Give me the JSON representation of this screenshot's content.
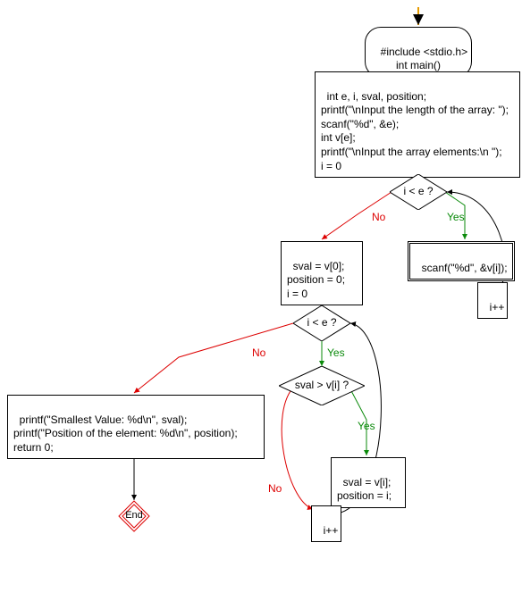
{
  "chart_data": {
    "type": "flowchart",
    "nodes": [
      {
        "id": "start",
        "kind": "start",
        "label": ""
      },
      {
        "id": "header",
        "kind": "rounded",
        "label": "#include <stdio.h>\nint main()"
      },
      {
        "id": "decl",
        "kind": "process",
        "label": "int e, i, sval, position;\nprintf(\"\\nInput the length of the array: \");\nscanf(\"%d\", &e);\nint v[e];\nprintf(\"\\nInput the array elements:\\n \");\ni = 0"
      },
      {
        "id": "cond1",
        "kind": "decision",
        "label": "i < e ?"
      },
      {
        "id": "scan",
        "kind": "process",
        "label": "scanf(\"%d\", &v[i]);"
      },
      {
        "id": "inc1",
        "kind": "process",
        "label": "i++"
      },
      {
        "id": "init2",
        "kind": "process",
        "label": "sval = v[0];\nposition = 0;\ni = 0"
      },
      {
        "id": "cond2",
        "kind": "decision",
        "label": "i < e ?"
      },
      {
        "id": "cond3",
        "kind": "decision",
        "label": "sval > v[i] ?"
      },
      {
        "id": "assign",
        "kind": "process",
        "label": "sval = v[i];\nposition = i;"
      },
      {
        "id": "inc2",
        "kind": "process",
        "label": "i++"
      },
      {
        "id": "out",
        "kind": "process",
        "label": "printf(\"Smallest Value: %d\\n\", sval);\nprintf(\"Position of the element: %d\\n\", position);\nreturn 0;"
      },
      {
        "id": "end",
        "kind": "end",
        "label": "End"
      }
    ],
    "edges": [
      {
        "from": "start",
        "to": "header"
      },
      {
        "from": "header",
        "to": "decl"
      },
      {
        "from": "decl",
        "to": "cond1"
      },
      {
        "from": "cond1",
        "to": "scan",
        "label": "Yes",
        "color": "green"
      },
      {
        "from": "scan",
        "to": "inc1"
      },
      {
        "from": "inc1",
        "to": "cond1"
      },
      {
        "from": "cond1",
        "to": "init2",
        "label": "No",
        "color": "red"
      },
      {
        "from": "init2",
        "to": "cond2"
      },
      {
        "from": "cond2",
        "to": "cond3",
        "label": "Yes",
        "color": "green"
      },
      {
        "from": "cond3",
        "to": "assign",
        "label": "Yes",
        "color": "green"
      },
      {
        "from": "assign",
        "to": "inc2"
      },
      {
        "from": "cond3",
        "to": "inc2",
        "label": "No",
        "color": "red"
      },
      {
        "from": "inc2",
        "to": "cond2"
      },
      {
        "from": "cond2",
        "to": "out",
        "label": "No",
        "color": "red"
      },
      {
        "from": "out",
        "to": "end"
      }
    ]
  },
  "labels": {
    "header": "#include <stdio.h>\nint main()",
    "decl": "int e, i, sval, position;\nprintf(\"\\nInput the length of the array: \");\nscanf(\"%d\", &e);\nint v[e];\nprintf(\"\\nInput the array elements:\\n \");\ni = 0",
    "cond1": "i < e ?",
    "scan": "scanf(\"%d\", &v[i]);",
    "inc1": "i++",
    "init2": "sval = v[0];\nposition = 0;\ni = 0",
    "cond2": "i < e ?",
    "cond3": "sval > v[i] ?",
    "assign": "sval = v[i];\nposition = i;",
    "inc2": "i++",
    "out": "printf(\"Smallest Value: %d\\n\", sval);\nprintf(\"Position of the element: %d\\n\", position);\nreturn 0;",
    "end": "End",
    "yes": "Yes",
    "no": "No"
  }
}
